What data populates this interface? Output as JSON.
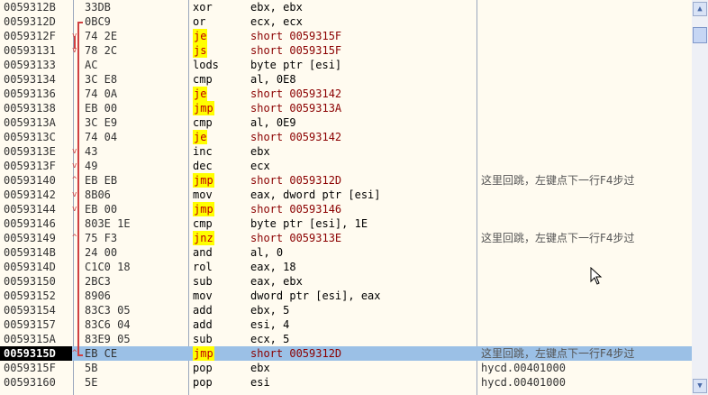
{
  "disasm": {
    "rows": [
      {
        "addr": "0059312B",
        "hex": "33DB",
        "mnem": "xor",
        "ops": "ebx, ebx",
        "cmt": ""
      },
      {
        "addr": "0059312D",
        "hex": "0BC9",
        "mnem": "or",
        "ops": "ecx, ecx",
        "cmt": ""
      },
      {
        "addr": "0059312F",
        "hex": "74 2E",
        "mnem": "je",
        "ops": "short 0059315F",
        "cmt": ""
      },
      {
        "addr": "00593131",
        "hex": "78 2C",
        "mnem": "js",
        "ops": "short 0059315F",
        "cmt": ""
      },
      {
        "addr": "00593133",
        "hex": "AC",
        "mnem": "lods",
        "ops": "byte ptr [esi]",
        "cmt": ""
      },
      {
        "addr": "00593134",
        "hex": "3C E8",
        "mnem": "cmp",
        "ops": "al, 0E8",
        "cmt": ""
      },
      {
        "addr": "00593136",
        "hex": "74 0A",
        "mnem": "je",
        "ops": "short 00593142",
        "cmt": ""
      },
      {
        "addr": "00593138",
        "hex": "EB 00",
        "mnem": "jmp",
        "ops": "short 0059313A",
        "cmt": ""
      },
      {
        "addr": "0059313A",
        "hex": "3C E9",
        "mnem": "cmp",
        "ops": "al, 0E9",
        "cmt": ""
      },
      {
        "addr": "0059313C",
        "hex": "74 04",
        "mnem": "je",
        "ops": "short 00593142",
        "cmt": ""
      },
      {
        "addr": "0059313E",
        "hex": "43",
        "mnem": "inc",
        "ops": "ebx",
        "cmt": ""
      },
      {
        "addr": "0059313F",
        "hex": "49",
        "mnem": "dec",
        "ops": "ecx",
        "cmt": ""
      },
      {
        "addr": "00593140",
        "hex": "EB EB",
        "mnem": "jmp",
        "ops": "short 0059312D",
        "cmt": "这里回跳，左键点下一行F4步过"
      },
      {
        "addr": "00593142",
        "hex": "8B06",
        "mnem": "mov",
        "ops": "eax, dword ptr [esi]",
        "cmt": ""
      },
      {
        "addr": "00593144",
        "hex": "EB 00",
        "mnem": "jmp",
        "ops": "short 00593146",
        "cmt": ""
      },
      {
        "addr": "00593146",
        "hex": "803E 1E",
        "mnem": "cmp",
        "ops": "byte ptr [esi], 1E",
        "cmt": ""
      },
      {
        "addr": "00593149",
        "hex": "75 F3",
        "mnem": "jnz",
        "ops": "short 0059313E",
        "cmt": "这里回跳，左键点下一行F4步过"
      },
      {
        "addr": "0059314B",
        "hex": "24 00",
        "mnem": "and",
        "ops": "al, 0",
        "cmt": ""
      },
      {
        "addr": "0059314D",
        "hex": "C1C0 18",
        "mnem": "rol",
        "ops": "eax, 18",
        "cmt": ""
      },
      {
        "addr": "00593150",
        "hex": "2BC3",
        "mnem": "sub",
        "ops": "eax, ebx",
        "cmt": ""
      },
      {
        "addr": "00593152",
        "hex": "8906",
        "mnem": "mov",
        "ops": "dword ptr [esi], eax",
        "cmt": ""
      },
      {
        "addr": "00593154",
        "hex": "83C3 05",
        "mnem": "add",
        "ops": "ebx, 5",
        "cmt": ""
      },
      {
        "addr": "00593157",
        "hex": "83C6 04",
        "mnem": "add",
        "ops": "esi, 4",
        "cmt": ""
      },
      {
        "addr": "0059315A",
        "hex": "83E9 05",
        "mnem": "sub",
        "ops": "ecx, 5",
        "cmt": ""
      },
      {
        "addr": "0059315D",
        "hex": "EB CE",
        "mnem": "jmp",
        "ops": "short 0059312D",
        "cmt": "这里回跳，左键点下一行F4步过"
      },
      {
        "addr": "0059315F",
        "hex": "5B",
        "mnem": "pop",
        "ops": "ebx",
        "cmt": "hycd.00401000"
      },
      {
        "addr": "00593160",
        "hex": "5E",
        "mnem": "pop",
        "ops": "esi",
        "cmt": "hycd.00401000"
      }
    ],
    "selected_row": 24,
    "colors": {
      "background": "#fffbf0",
      "selection": "#9bc0e6",
      "jump_highlight": "#ffff00",
      "jump_text": "#c00000",
      "constant": "#9b7b00",
      "jump_arrow": "#d04040"
    }
  },
  "scrollbar": {
    "up_icon": "up-arrow-icon",
    "down_icon": "down-arrow-icon"
  }
}
